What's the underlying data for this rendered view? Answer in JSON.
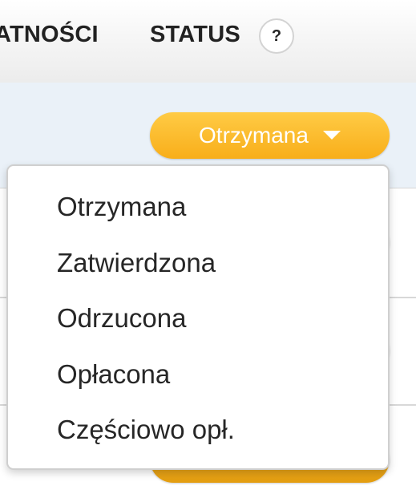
{
  "header": {
    "payments_column": "ATNOŚCI",
    "status_column": "STATUS",
    "help_label": "?"
  },
  "status_button": {
    "selected": "Otrzymana"
  },
  "status_menu": {
    "options": [
      "Otrzymana",
      "Zatwierdzona",
      "Odrzucona",
      "Opłacona",
      "Częściowo opł."
    ]
  },
  "colors": {
    "pill_top": "#ffcb45",
    "pill_bottom": "#f8ae1a",
    "row_highlight": "#eaf1f8",
    "menu_border": "#cfcfcf",
    "text": "#222222"
  },
  "icons": {
    "help": "help-icon",
    "dropdown": "caret-down-icon"
  }
}
